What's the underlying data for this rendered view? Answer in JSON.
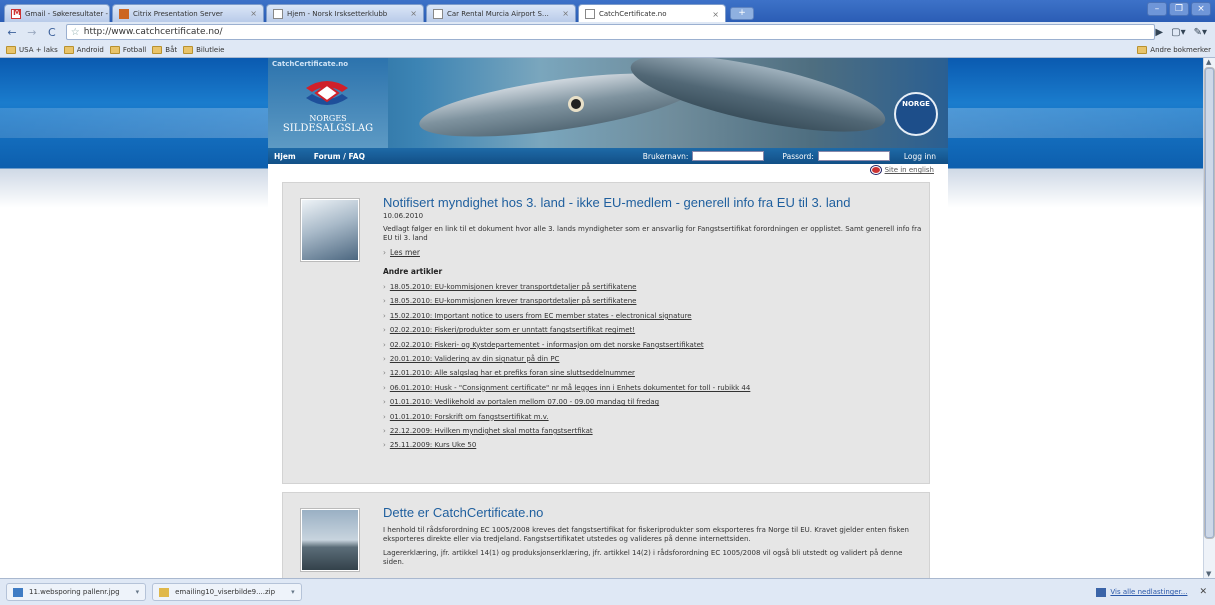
{
  "browser": {
    "tabs": [
      {
        "label": "Gmail - Søkeresultater - roy…",
        "icon": "gmail-icon"
      },
      {
        "label": "Citrix Presentation Server",
        "icon": "citrix-icon"
      },
      {
        "label": "Hjem - Norsk Irsksetterklubb",
        "icon": "page-icon"
      },
      {
        "label": "Car Rental Murcia Airport S…",
        "icon": "page-icon"
      },
      {
        "label": "CatchCertificate.no",
        "icon": "page-icon",
        "active": true
      }
    ],
    "url": "http://www.catchcertificate.no/",
    "bookmarks": [
      "USA + laks",
      "Android",
      "Fotball",
      "Båt",
      "Bilutleie"
    ],
    "other_bookmarks": "Andre bokmerker"
  },
  "site": {
    "banner_small": "CatchCertificate.no",
    "logo_line1": "NORGES",
    "logo_line2": "SILDESALGSLAG",
    "badge": "NORGE",
    "nav": {
      "home": "Hjem",
      "forum": "Forum / FAQ"
    },
    "login": {
      "username_label": "Brukernavn:",
      "password_label": "Passord:",
      "button": "Logg inn"
    },
    "english_link": "Site in english"
  },
  "article1": {
    "title": "Notifisert myndighet hos 3. land - ikke EU-medlem - generell info fra EU til 3. land",
    "date": "10.06.2010",
    "text": "Vedlagt følger en link til et dokument hvor alle 3. lands myndigheter som er ansvarlig for Fangstsertifikat forordningen er opplistet. Samt generell info fra EU til 3. land",
    "more": "Les mer",
    "other_heading": "Andre artikler",
    "other": [
      "18.05.2010: EU-kommisjonen krever transportdetaljer på sertifikatene",
      "18.05.2010: EU-kommisjonen krever transportdetaljer på sertifikatene",
      "15.02.2010: Important notice to users from EC member states - electronical signature",
      "02.02.2010: Fiskeri/produkter som er unntatt fangstsertifikat regimet!",
      "02.02.2010: Fiskeri- og Kystdepartementet - informasjon om det norske Fangstsertifikatet",
      "20.01.2010: Validering av din signatur på din PC",
      "12.01.2010: Alle salgslag har et prefiks foran sine sluttseddelnummer",
      "06.01.2010: Husk - \"Consignment certificate\" nr må legges inn i Enhets dokumentet for toll - rubikk 44",
      "01.01.2010: Vedlikehold av portalen mellom 07.00 - 09.00 mandag til fredag",
      "01.01.2010: Forskrift om fangstsertifikat m.v.",
      "22.12.2009: Hvilken myndighet skal motta fangstsertfikat",
      "25.11.2009: Kurs Uke 50"
    ]
  },
  "article2": {
    "title": "Dette er CatchCertificate.no",
    "text1": "I henhold til rådsforordning EC 1005/2008 kreves det fangstsertifikat for fiskeriprodukter som eksporteres fra Norge til EU. Kravet gjelder enten fisken eksporteres direkte eller via tredjeland. Fangstsertifikatet utstedes og valideres på denne internettsiden.",
    "text2": "Lagererklæring, jfr. artikkel 14(1) og produksjonserklæring, jfr. artikkel 14(2) i rådsforordning EC 1005/2008 vil også bli utstedt og validert på denne siden."
  },
  "downloads": {
    "items": [
      "11.websporing pallenr.jpg",
      "emailing10_viserbilde9....zip"
    ],
    "show_all": "Vis alle nedlastinger..."
  }
}
